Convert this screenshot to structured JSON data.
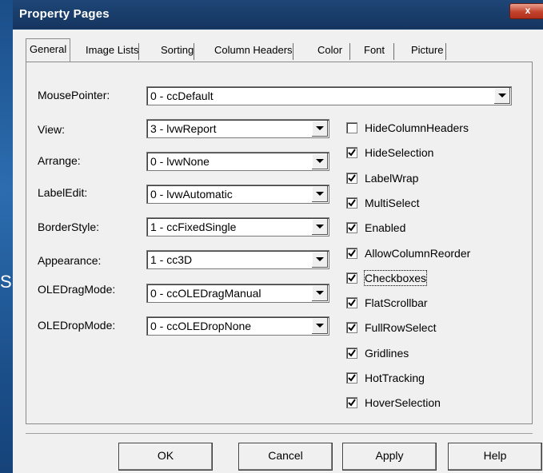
{
  "desktop": {
    "text": "S"
  },
  "window": {
    "title": "Property Pages",
    "close_glyph": "x"
  },
  "tabs": [
    {
      "label": "General"
    },
    {
      "label": "Image Lists"
    },
    {
      "label": "Sorting"
    },
    {
      "label": "Column Headers"
    },
    {
      "label": "Color"
    },
    {
      "label": "Font"
    },
    {
      "label": "Picture"
    }
  ],
  "fields": {
    "mousepointer": {
      "label": "MousePointer:",
      "value": "0 - ccDefault"
    },
    "view": {
      "label": "View:",
      "value": "3 - lvwReport"
    },
    "arrange": {
      "label": "Arrange:",
      "value": "0 - lvwNone"
    },
    "labeledit": {
      "label": "LabelEdit:",
      "value": "0 - lvwAutomatic"
    },
    "borderstyle": {
      "label": "BorderStyle:",
      "value": "1 - ccFixedSingle"
    },
    "appearance": {
      "label": "Appearance:",
      "value": "1 - cc3D"
    },
    "oledragmode": {
      "label": "OLEDragMode:",
      "value": "0 - ccOLEDragManual"
    },
    "oledropmode": {
      "label": "OLEDropMode:",
      "value": "0 - ccOLEDropNone"
    }
  },
  "checkboxes": [
    {
      "label": "HideColumnHeaders",
      "checked": false
    },
    {
      "label": "HideSelection",
      "checked": true
    },
    {
      "label": "LabelWrap",
      "checked": true
    },
    {
      "label": "MultiSelect",
      "checked": true
    },
    {
      "label": "Enabled",
      "checked": true
    },
    {
      "label": "AllowColumnReorder",
      "checked": true
    },
    {
      "label": "Checkboxes",
      "checked": true
    },
    {
      "label": "FlatScrollbar",
      "checked": true
    },
    {
      "label": "FullRowSelect",
      "checked": true
    },
    {
      "label": "Gridlines",
      "checked": true
    },
    {
      "label": "HotTracking",
      "checked": true
    },
    {
      "label": "HoverSelection",
      "checked": true
    }
  ],
  "buttons": {
    "ok": "OK",
    "cancel": "Cancel",
    "apply": "Apply",
    "help": "Help"
  },
  "colors": {
    "titlebar": "#1e4677",
    "close_button": "#c2422c",
    "dialog_face": "#f0f0f0"
  }
}
